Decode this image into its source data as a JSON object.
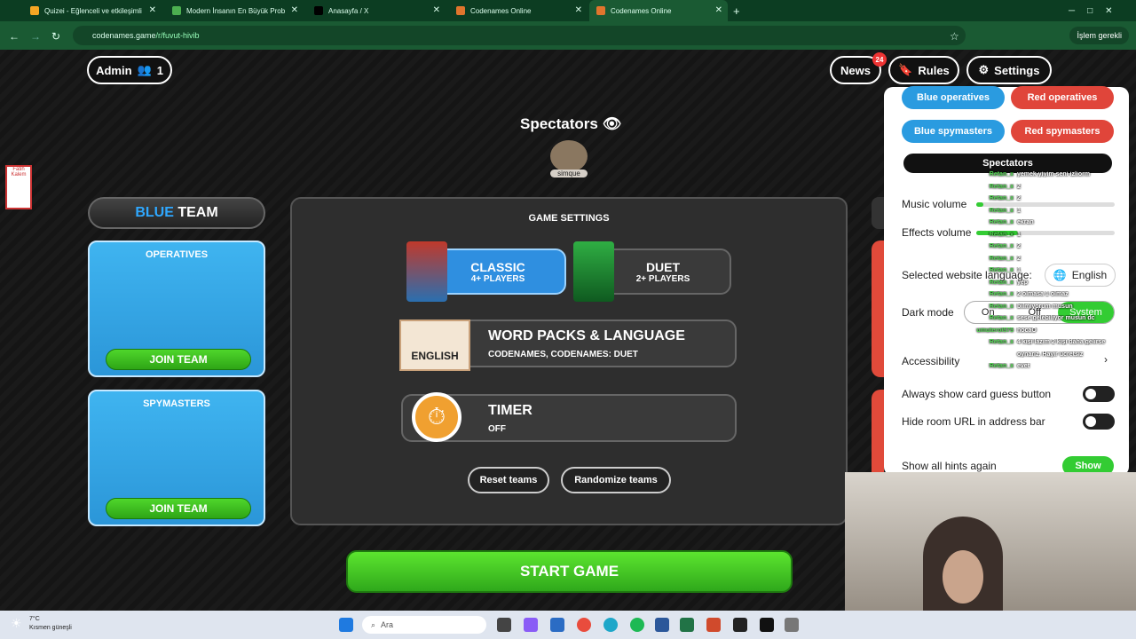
{
  "browser": {
    "tabs": [
      {
        "title": "Quizei - Eğlenceli ve etkileşimli",
        "fav": "#f5a623"
      },
      {
        "title": "Modern İnsanın En Büyük Prob",
        "fav": "#4caf50"
      },
      {
        "title": "Anasayfa / X",
        "fav": "#000000"
      },
      {
        "title": "Codenames Online",
        "fav": "#e0752d"
      },
      {
        "title": "Codenames Online",
        "fav": "#e0752d"
      }
    ],
    "url_host": "codenames.game",
    "url_path": "/r/fuvut-hivib",
    "work_label": "İşlem gerekli"
  },
  "header": {
    "admin_label": "Admin",
    "player_count": "1",
    "news_label": "News",
    "news_badge": "24",
    "rules_label": "Rules",
    "settings_label": "Settings"
  },
  "spectators": {
    "title": "Spectators",
    "avatar_name": "simque"
  },
  "blue_team": {
    "title_colored": "BLUE",
    "title_rest": " TEAM",
    "operatives": "OPERATIVES",
    "spymasters": "SPYMASTERS",
    "join": "JOIN TEAM"
  },
  "game_settings": {
    "title": "GAME SETTINGS",
    "classic": {
      "label": "CLASSIC",
      "sub": "4+ PLAYERS"
    },
    "duet": {
      "label": "DUET",
      "sub": "2+ PLAYERS"
    },
    "word_packs": {
      "label": "WORD PACKS & LANGUAGE",
      "sub": "CODENAMES, CODENAMES: DUET",
      "badge": "ENGLISH"
    },
    "timer": {
      "label": "TIMER",
      "sub": "OFF"
    },
    "reset": "Reset teams",
    "randomize": "Randomize teams"
  },
  "start_label": "START GAME",
  "panel": {
    "blue_operatives": "Blue operatives",
    "red_operatives": "Red operatives",
    "blue_spymasters": "Blue spymasters",
    "red_spymasters": "Red spymasters",
    "spectators": "Spectators",
    "music_volume": "Music volume",
    "effects_volume": "Effects volume",
    "language_label": "Selected website language:",
    "language_value": "English",
    "dark_mode": "Dark mode",
    "dm_on": "On",
    "dm_off": "Off",
    "dm_system": "System",
    "accessibility": "Accessibility",
    "always_show": "Always show card guess button",
    "hide_url": "Hide room URL in address bar",
    "show_hints": "Show all hints again",
    "show_btn": "Show",
    "music_level": 0.05,
    "effects_level": 0.3
  },
  "chat": [
    {
      "name": "Retan_x",
      "msg": "yemek yiyim seni izliorm"
    },
    {
      "name": "Retan_x",
      "msg": "2"
    },
    {
      "name": "Retan_x",
      "msg": "2"
    },
    {
      "name": "Retan_x",
      "msg": "1"
    },
    {
      "name": "Retan_x",
      "msg": "ekran"
    },
    {
      "name": "Retan_x",
      "msg": "1"
    },
    {
      "name": "Retan_x",
      "msg": "2"
    },
    {
      "name": "Retan_x",
      "msg": "2"
    },
    {
      "name": "Retan_x",
      "msg": "1"
    },
    {
      "name": "Retan_x",
      "msg": "yep"
    },
    {
      "name": "Retan_x",
      "msg": "2 olmasa 1 olmaz"
    },
    {
      "name": "Retan_x",
      "msg": "bilmiyorum musun"
    },
    {
      "name": "Retan_x",
      "msg": "sese gelebiliyor musun dc"
    },
    {
      "name": "umuterol575",
      "msg": "hocaÖ"
    },
    {
      "name": "Retan_x",
      "msg": "4 kişi lazım 2 kişi daha gelirse"
    },
    {
      "name": "",
      "msg": "oynarız. Hayır ücretsiz"
    },
    {
      "name": "Retan_x",
      "msg": "evet"
    }
  ],
  "taskbar": {
    "weather_temp": "7°C",
    "weather_desc": "Kısmen güneşli",
    "search": "Ara"
  },
  "sidebar_logo": "Fatih Kalem"
}
